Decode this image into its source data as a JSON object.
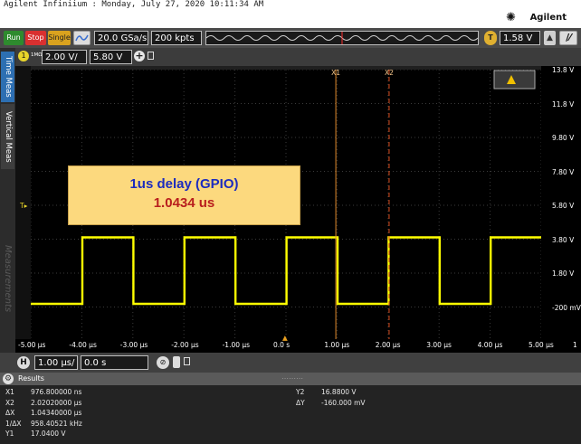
{
  "title_bar": {
    "text": "Agilent Infiniium : Monday, July 27, 2020 10:11:34 AM"
  },
  "brand": {
    "name": "Agilent",
    "color": "#1a1a1a"
  },
  "toolbar": {
    "run_label": "Run",
    "stop_label": "Stop",
    "single_label": "Single",
    "sample_rate": "20.0 GSa/s",
    "memory_depth": "200 kpts",
    "trigger_level": "1.58 V",
    "trigger_badge": "T",
    "run_color": "#2e8b2e",
    "stop_color": "#d93030",
    "single_color": "#d9a21e"
  },
  "channel": {
    "number": "1",
    "impedance": "1MΩ",
    "scale": "2.00 V/",
    "offset": "5.80 V",
    "trace_color": "#ffff00"
  },
  "side_tabs": {
    "time_meas": "Time Meas",
    "vertical_meas": "Vertical Meas",
    "measurements": "Measurements"
  },
  "markers": {
    "x1": "X1",
    "x2": "X2",
    "t": "T",
    "x1_color": "#e08a2c",
    "x2_color": "#e05020"
  },
  "y_ticks": [
    "13.8 V",
    "11.8 V",
    "9.80 V",
    "7.80 V",
    "5.80 V",
    "3.80 V",
    "1.80 V",
    "-200 mV"
  ],
  "x_ticks": [
    "-5.00 µs",
    "-4.00 µs",
    "-3.00 µs",
    "-2.00 µs",
    "-1.00 µs",
    "0.0 s",
    "1.00 µs",
    "2.00 µs",
    "3.00 µs",
    "4.00 µs",
    "5.00 µs"
  ],
  "x_end_label": "1",
  "annotation": {
    "title": "1us delay (GPIO)",
    "value": "1.0434 us"
  },
  "horizontal": {
    "badge": "H",
    "scale": "1.00 µs/",
    "position": "0.0 s"
  },
  "results": {
    "header": "Results",
    "left": [
      {
        "label": "X1",
        "value": "976.800000 ns"
      },
      {
        "label": "X2",
        "value": "2.02020000 µs"
      },
      {
        "label": "ΔX",
        "value": "1.04340000 µs"
      },
      {
        "label": "1/ΔX",
        "value": "958.40521 kHz"
      },
      {
        "label": "Y1",
        "value": "17.0400 V"
      }
    ],
    "right": [
      {
        "label": "Y2",
        "value": "16.8800 V"
      },
      {
        "label": "ΔY",
        "value": "-160.000 mV"
      }
    ]
  }
}
